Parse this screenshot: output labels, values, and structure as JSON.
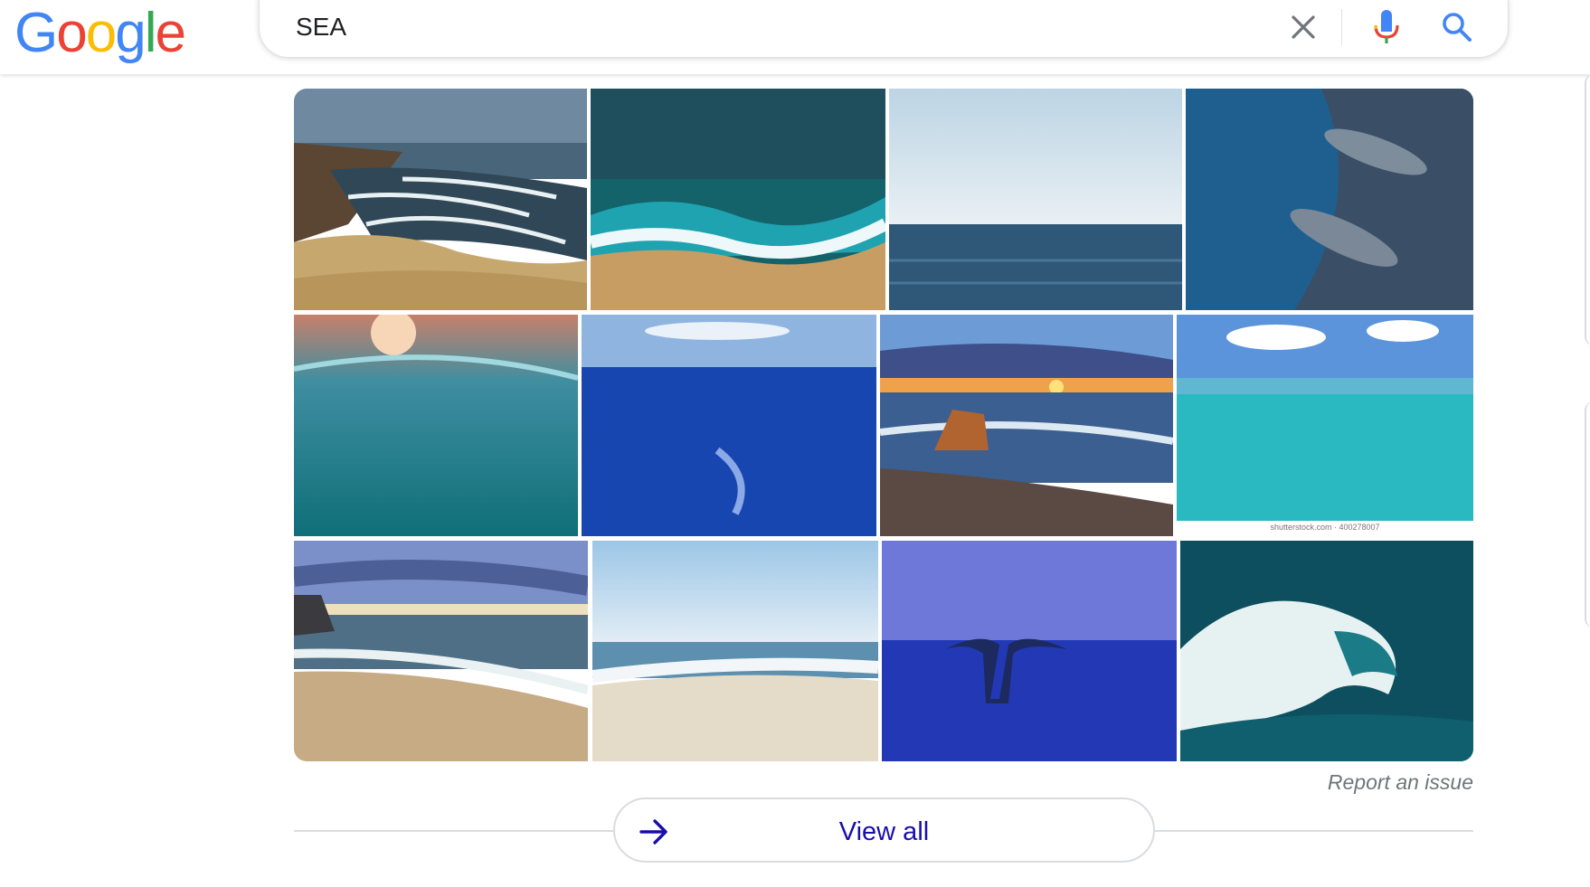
{
  "header": {
    "logo_letters": [
      {
        "ch": "G",
        "color": "#4285F4"
      },
      {
        "ch": "o",
        "color": "#EA4335"
      },
      {
        "ch": "o",
        "color": "#FBBC05"
      },
      {
        "ch": "g",
        "color": "#4285F4"
      },
      {
        "ch": "l",
        "color": "#34A853"
      },
      {
        "ch": "e",
        "color": "#EA4335"
      }
    ],
    "search_query": "SEA",
    "icons": [
      "close-icon",
      "mic-icon",
      "search-icon"
    ]
  },
  "images": [
    {
      "name": "image-coast-cliffs",
      "subject": "desert coastline cliffs"
    },
    {
      "name": "image-aerial-wave-sand",
      "subject": "aerial wave on sand"
    },
    {
      "name": "image-sea-horizon",
      "subject": "calm sea horizon"
    },
    {
      "name": "image-dolphins",
      "subject": "dolphins underwater"
    },
    {
      "name": "image-underwater-sun",
      "subject": "underwater sunlight"
    },
    {
      "name": "image-deep-blue-sea",
      "subject": "deep blue open sea"
    },
    {
      "name": "image-sunset-rock",
      "subject": "sunset with rock on shore"
    },
    {
      "name": "image-turquoise-sea",
      "subject": "turquoise sea",
      "caption": "shutterstock.com · 400278007"
    },
    {
      "name": "image-beach-dusk",
      "subject": "beach at dusk"
    },
    {
      "name": "image-bright-beach",
      "subject": "bright beach waves"
    },
    {
      "name": "image-whale-tail",
      "subject": "whale tail at blue hour"
    },
    {
      "name": "image-crashing-wave",
      "subject": "crashing wave"
    }
  ],
  "report_issue": "Report an issue",
  "view_all": "View all",
  "colors": {
    "link": "#1a0dab",
    "muted": "#70757a",
    "border": "#dadce0"
  }
}
